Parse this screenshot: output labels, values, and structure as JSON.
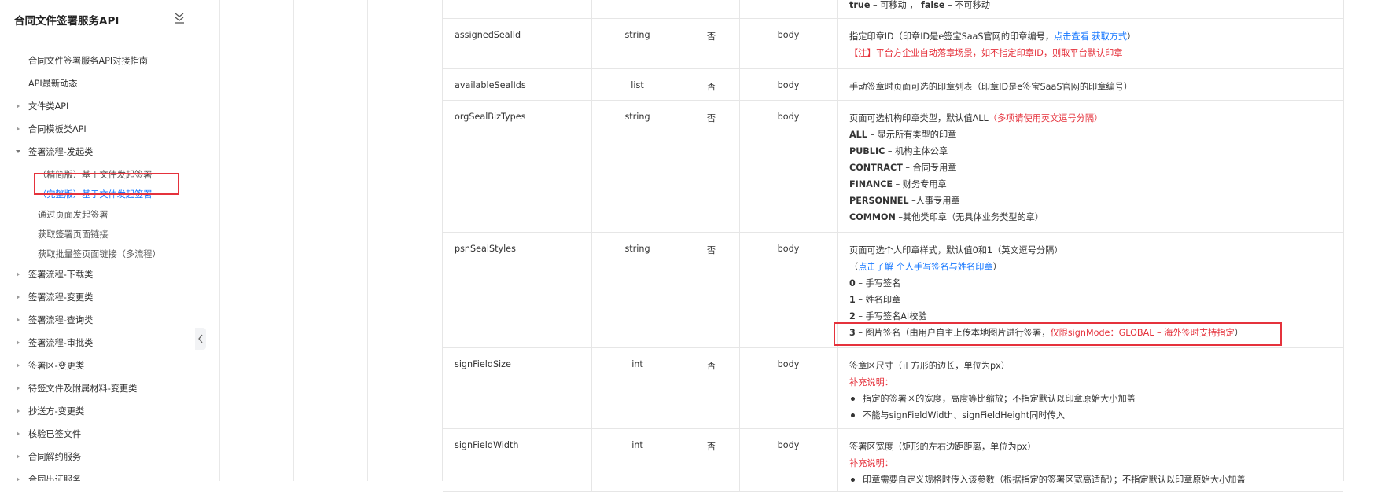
{
  "sidebar": {
    "title": "合同文件签署服务API",
    "collapse_icon": "collapse-all-icon",
    "items": [
      {
        "label": "合同文件签署服务API对接指南",
        "level": 1,
        "expandable": false
      },
      {
        "label": "API最新动态",
        "level": 1,
        "expandable": false
      },
      {
        "label": "文件类API",
        "level": 1,
        "expandable": true,
        "expanded": false
      },
      {
        "label": "合同模板类API",
        "level": 1,
        "expandable": true,
        "expanded": false
      },
      {
        "label": "签署流程-发起类",
        "level": 1,
        "expandable": true,
        "expanded": true
      },
      {
        "label": "（精简版）基于文件发起签署",
        "level": 2
      },
      {
        "label": "（完整版）基于文件发起签署",
        "level": 2,
        "active": true
      },
      {
        "label": "通过页面发起签署",
        "level": 2
      },
      {
        "label": "获取签署页面链接",
        "level": 2
      },
      {
        "label": "获取批量签页面链接（多流程）",
        "level": 2
      },
      {
        "label": "签署流程-下载类",
        "level": 1,
        "expandable": true,
        "expanded": false
      },
      {
        "label": "签署流程-变更类",
        "level": 1,
        "expandable": true,
        "expanded": false
      },
      {
        "label": "签署流程-查询类",
        "level": 1,
        "expandable": true,
        "expanded": false
      },
      {
        "label": "签署流程-审批类",
        "level": 1,
        "expandable": true,
        "expanded": false
      },
      {
        "label": "签署区-变更类",
        "level": 1,
        "expandable": true,
        "expanded": false
      },
      {
        "label": "待签文件及附属材料-变更类",
        "level": 1,
        "expandable": true,
        "expanded": false
      },
      {
        "label": "抄送方-变更类",
        "level": 1,
        "expandable": true,
        "expanded": false
      },
      {
        "label": "核验已签文件",
        "level": 1,
        "expandable": true,
        "expanded": false
      },
      {
        "label": "合同解约服务",
        "level": 1,
        "expandable": true,
        "expanded": false
      },
      {
        "label": "合同出证服务",
        "level": 1,
        "expandable": true,
        "expanded": false
      }
    ]
  },
  "table": {
    "rows": [
      {
        "name": "",
        "type": "",
        "required": "",
        "location": "",
        "desc": [
          {
            "kind": "text",
            "parts": [
              {
                "t": "true",
                "style": "bold"
              },
              {
                "t": " – 可移动 ， "
              },
              {
                "t": "false",
                "style": "bold"
              },
              {
                "t": " – 不可移动"
              }
            ]
          }
        ]
      },
      {
        "name": "assignedSealId",
        "type": "string",
        "required": "否",
        "location": "body",
        "desc": [
          {
            "kind": "text",
            "parts": [
              {
                "t": "指定印章ID（印章ID是e签宝SaaS官网的印章编号，"
              },
              {
                "t": "点击查看 获取方式",
                "style": "link"
              },
              {
                "t": "）"
              }
            ]
          },
          {
            "kind": "text",
            "parts": [
              {
                "t": "【注】平台方企业自动落章场景，如不指定印章ID，则取平台默认印章",
                "style": "red"
              }
            ]
          }
        ]
      },
      {
        "name": "availableSealIds",
        "type": "list",
        "required": "否",
        "location": "body",
        "desc": [
          {
            "kind": "text",
            "parts": [
              {
                "t": "手动签章时页面可选的印章列表（印章ID是e签宝SaaS官网的印章编号）"
              }
            ]
          }
        ]
      },
      {
        "name": "orgSealBizTypes",
        "type": "string",
        "required": "否",
        "location": "body",
        "desc": [
          {
            "kind": "text",
            "parts": [
              {
                "t": "页面可选机构印章类型，默认值ALL"
              },
              {
                "t": "（多项请使用英文逗号分隔）",
                "style": "red"
              }
            ]
          },
          {
            "kind": "text",
            "parts": [
              {
                "t": "ALL",
                "style": "bold"
              },
              {
                "t": " – 显示所有类型的印章"
              }
            ]
          },
          {
            "kind": "text",
            "parts": [
              {
                "t": "PUBLIC",
                "style": "bold"
              },
              {
                "t": " – 机构主体公章"
              }
            ]
          },
          {
            "kind": "text",
            "parts": [
              {
                "t": "CONTRACT",
                "style": "bold"
              },
              {
                "t": " – 合同专用章"
              }
            ]
          },
          {
            "kind": "text",
            "parts": [
              {
                "t": "FINANCE",
                "style": "bold"
              },
              {
                "t": " – 财务专用章"
              }
            ]
          },
          {
            "kind": "text",
            "parts": [
              {
                "t": "PERSONNEL",
                "style": "bold"
              },
              {
                "t": " –人事专用章"
              }
            ]
          },
          {
            "kind": "text",
            "parts": [
              {
                "t": "COMMON",
                "style": "bold"
              },
              {
                "t": " –其他类印章（无具体业务类型的章）"
              }
            ]
          }
        ]
      },
      {
        "name": "psnSealStyles",
        "type": "string",
        "required": "否",
        "location": "body",
        "desc": [
          {
            "kind": "text",
            "parts": [
              {
                "t": "页面可选个人印章样式，默认值0和1（英文逗号分隔）"
              }
            ]
          },
          {
            "kind": "text",
            "parts": [
              {
                "t": "（"
              },
              {
                "t": "点击了解 个人手写签名与姓名印章",
                "style": "link"
              },
              {
                "t": "）"
              }
            ]
          },
          {
            "kind": "text",
            "parts": [
              {
                "t": "0",
                "style": "bold"
              },
              {
                "t": " – 手写签名"
              }
            ]
          },
          {
            "kind": "text",
            "parts": [
              {
                "t": "1",
                "style": "bold"
              },
              {
                "t": " – 姓名印章"
              }
            ]
          },
          {
            "kind": "text",
            "parts": [
              {
                "t": "2",
                "style": "bold"
              },
              {
                "t": " – 手写签名AI校验"
              }
            ]
          },
          {
            "kind": "text",
            "parts": [
              {
                "t": "3",
                "style": "bold"
              },
              {
                "t": " – 图片签名（由用户自主上传本地图片进行签署，"
              },
              {
                "t": "仅限signMode：GLOBAL – 海外签时支持指定",
                "style": "red"
              },
              {
                "t": "）"
              }
            ]
          }
        ]
      },
      {
        "name": "signFieldSize",
        "type": "int",
        "required": "否",
        "location": "body",
        "desc": [
          {
            "kind": "text",
            "parts": [
              {
                "t": "签章区尺寸（正方形的边长，单位为px）"
              }
            ]
          },
          {
            "kind": "text",
            "parts": [
              {
                "t": "补充说明：",
                "style": "red"
              }
            ]
          },
          {
            "kind": "bullet",
            "parts": [
              {
                "t": "指定的签署区的宽度，高度等比缩放；不指定默认以印章原始大小加盖"
              }
            ]
          },
          {
            "kind": "bullet",
            "parts": [
              {
                "t": "不能与signFieldWidth、signFieldHeight同时传入"
              }
            ]
          }
        ]
      },
      {
        "name": "signFieldWidth",
        "type": "int",
        "required": "否",
        "location": "body",
        "desc": [
          {
            "kind": "text",
            "parts": [
              {
                "t": "签署区宽度（矩形的左右边距距离，单位为px）"
              }
            ]
          },
          {
            "kind": "text",
            "parts": [
              {
                "t": "补充说明：",
                "style": "red"
              }
            ]
          },
          {
            "kind": "bullet",
            "parts": [
              {
                "t": "印章需要自定义规格时传入该参数（根据指定的签署区宽高适配）；不指定默认以印章原始大小加盖"
              }
            ]
          }
        ]
      }
    ]
  }
}
